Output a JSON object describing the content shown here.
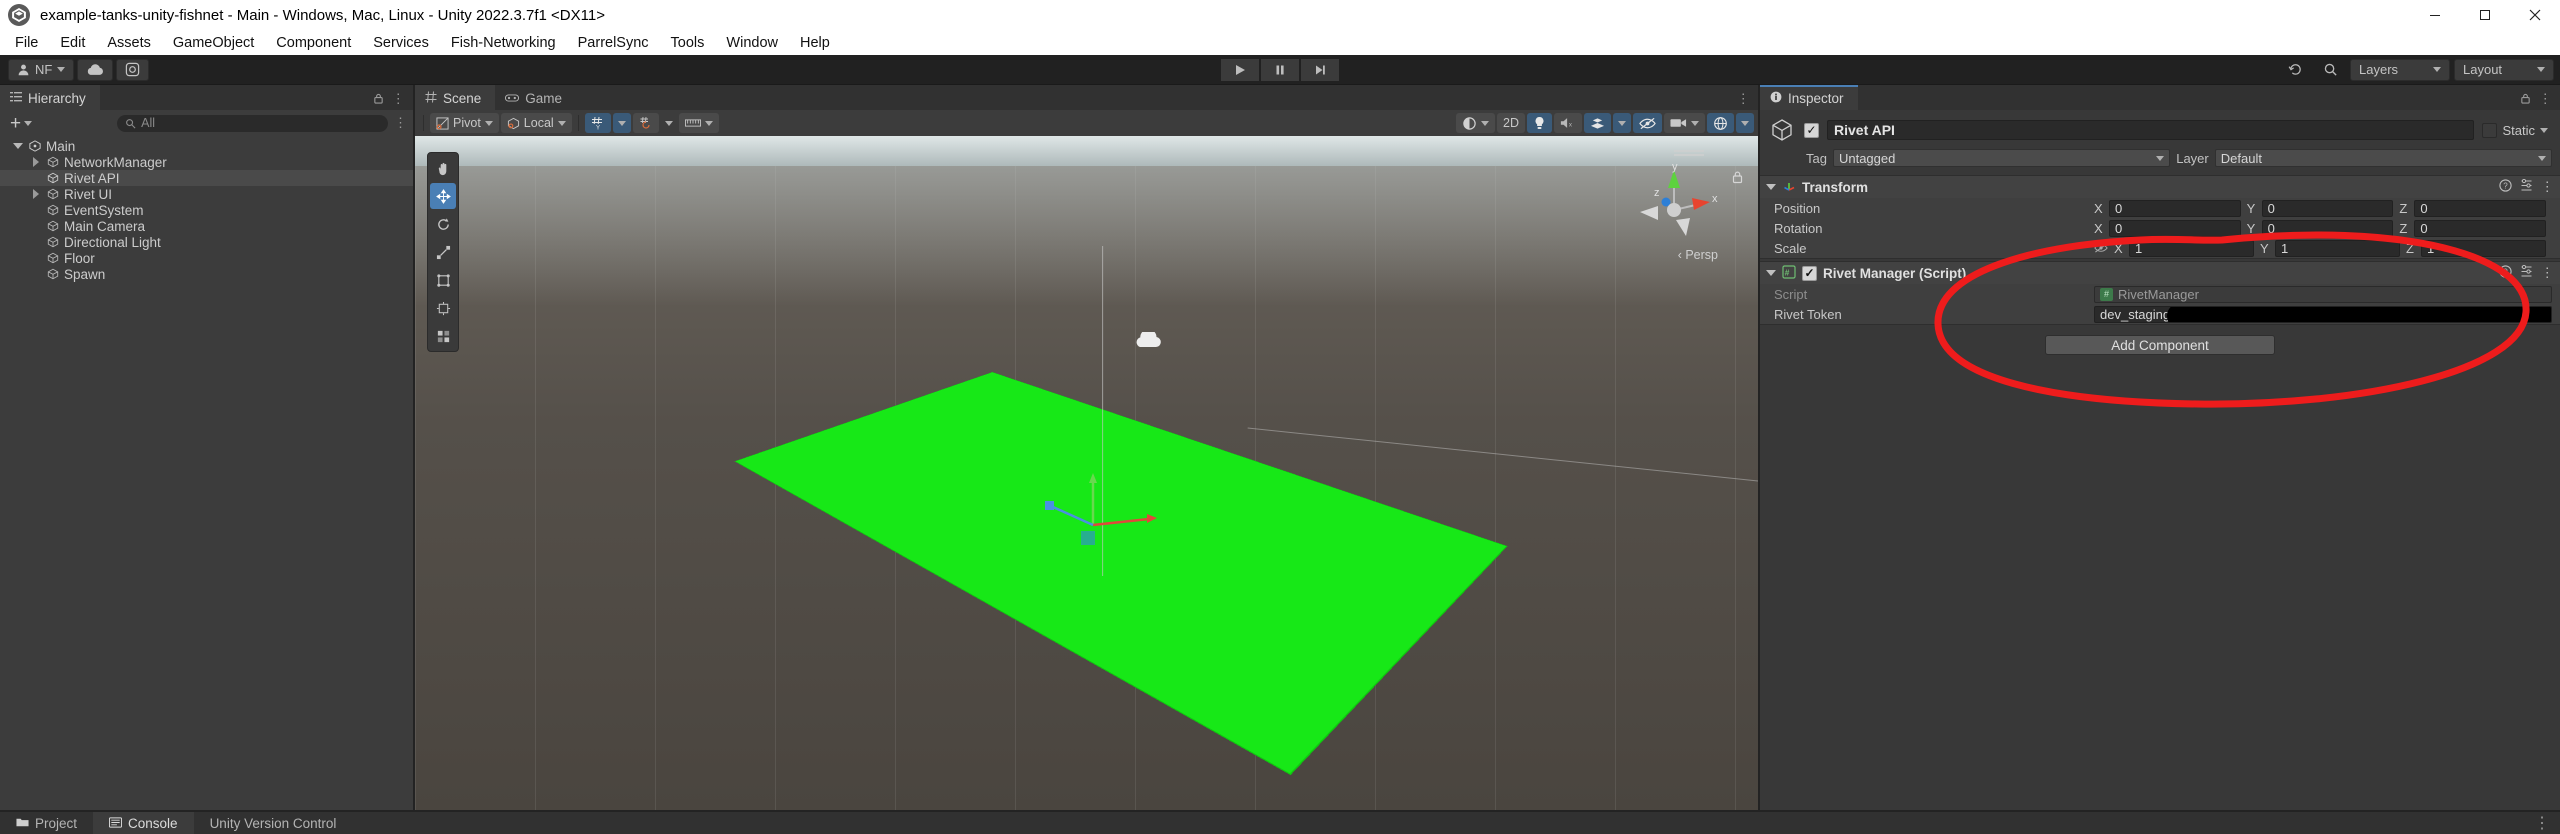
{
  "window": {
    "title": "example-tanks-unity-fishnet - Main - Windows, Mac, Linux - Unity 2022.3.7f1 <DX11>",
    "minimize": "—",
    "maximize": "☐",
    "close": "✕"
  },
  "menubar": {
    "items": [
      "File",
      "Edit",
      "Assets",
      "GameObject",
      "Component",
      "Services",
      "Fish-Networking",
      "ParrelSync",
      "Tools",
      "Window",
      "Help"
    ]
  },
  "toolbar": {
    "account_label": "NF",
    "cloud_icon": "cloud-icon",
    "settings_icon": "gear-icon",
    "play_icon": "play-icon",
    "pause_icon": "pause-icon",
    "step_icon": "step-icon",
    "undo_history_icon": "undo-history-icon",
    "search_icon": "search-icon",
    "layers_label": "Layers",
    "layout_label": "Layout"
  },
  "hierarchy": {
    "tab_label": "Hierarchy",
    "tab_icon": "hierarchy-icon",
    "add_label": "+",
    "search_placeholder": "All",
    "items": [
      {
        "label": "Main",
        "indent": 0,
        "twisty": "down",
        "selected": false
      },
      {
        "label": "NetworkManager",
        "indent": 1,
        "twisty": "right",
        "selected": false
      },
      {
        "label": "Rivet API",
        "indent": 1,
        "twisty": "none",
        "selected": true
      },
      {
        "label": "Rivet UI",
        "indent": 1,
        "twisty": "right",
        "selected": false
      },
      {
        "label": "EventSystem",
        "indent": 1,
        "twisty": "none",
        "selected": false
      },
      {
        "label": "Main Camera",
        "indent": 1,
        "twisty": "none",
        "selected": false
      },
      {
        "label": "Directional Light",
        "indent": 1,
        "twisty": "none",
        "selected": false
      },
      {
        "label": "Floor",
        "indent": 1,
        "twisty": "none",
        "selected": false
      },
      {
        "label": "Spawn",
        "indent": 1,
        "twisty": "none",
        "selected": false
      }
    ]
  },
  "scene": {
    "tabs": [
      {
        "label": "Scene",
        "icon": "scene-grid-icon",
        "active": true
      },
      {
        "label": "Game",
        "icon": "gamepad-icon",
        "active": false
      }
    ],
    "pivot_label": "Pivot",
    "local_label": "Local",
    "twod_label": "2D",
    "view_label": "Persp",
    "tools": [
      "hand-tool-icon",
      "move-tool-icon",
      "rotate-tool-icon",
      "scale-tool-icon",
      "rect-tool-icon",
      "transform-tool-icon",
      "custom-tool-icon"
    ],
    "gizmo_axes": [
      "x",
      "y",
      "z"
    ],
    "shading_icon": "shading-mode-icon",
    "lighting_icon": "lightbulb-icon",
    "audio_icon": "audio-mute-icon",
    "fx_icon": "effects-icon",
    "hidden_icon": "visibility-off-icon",
    "camera_icon": "scene-camera-icon",
    "gizmos_icon": "gizmos-icon",
    "lock_icon": "lock-icon"
  },
  "inspector": {
    "tab_label": "Inspector",
    "tab_icon": "info-icon",
    "object_name": "Rivet API",
    "object_enabled": "✓",
    "static_label": "Static",
    "tag_label": "Tag",
    "tag_value": "Untagged",
    "layer_label": "Layer",
    "layer_value": "Default",
    "components": [
      {
        "name": "Transform",
        "icon": "transform-icon",
        "has_checkbox": false,
        "rows": [
          {
            "label": "Position",
            "type": "vec3",
            "values": [
              "0",
              "0",
              "0"
            ],
            "axes": [
              "X",
              "Y",
              "Z"
            ]
          },
          {
            "label": "Rotation",
            "type": "vec3",
            "values": [
              "0",
              "0",
              "0"
            ],
            "axes": [
              "X",
              "Y",
              "Z"
            ]
          },
          {
            "label": "Scale",
            "type": "vec3",
            "values": [
              "1",
              "1",
              "1"
            ],
            "axes": [
              "X",
              "Y",
              "Z"
            ],
            "lock_icon": "constrain-proportions-off-icon"
          }
        ]
      },
      {
        "name": "Rivet Manager (Script)",
        "icon": "cs-script-icon",
        "has_checkbox": true,
        "enabled": "✓",
        "rows": [
          {
            "label": "Script",
            "type": "object",
            "value": "RivetManager",
            "readonly": true
          },
          {
            "label": "Rivet Token",
            "type": "text",
            "value": "dev_staging",
            "redacted": true
          }
        ]
      }
    ],
    "add_component_label": "Add Component",
    "help_icon": "help-icon",
    "preset_icon": "preset-icon",
    "menu_icon": "kebab-menu-icon"
  },
  "annotation": {
    "shape": "red-ellipse",
    "color": "#ee1c1c"
  },
  "bottom": {
    "tabs": [
      {
        "label": "Project",
        "icon": "folder-icon",
        "active": false
      },
      {
        "label": "Console",
        "icon": "console-icon",
        "active": true
      },
      {
        "label": "Unity Version Control",
        "icon": "version-control-icon",
        "active": false
      }
    ]
  }
}
